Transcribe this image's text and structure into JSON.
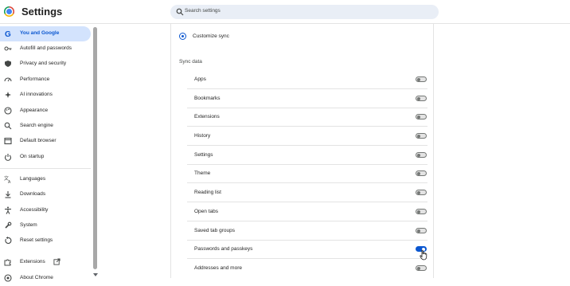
{
  "app": {
    "title": "Settings"
  },
  "search": {
    "placeholder": "Search settings"
  },
  "sidebar": {
    "items": [
      {
        "label": "You and Google",
        "icon": "google-g-icon",
        "active": true
      },
      {
        "label": "Autofill and passwords",
        "icon": "key-icon"
      },
      {
        "label": "Privacy and security",
        "icon": "shield-icon"
      },
      {
        "label": "Performance",
        "icon": "speedometer-icon"
      },
      {
        "label": "AI innovations",
        "icon": "sparkle-icon"
      },
      {
        "label": "Appearance",
        "icon": "palette-icon"
      },
      {
        "label": "Search engine",
        "icon": "search-icon"
      },
      {
        "label": "Default browser",
        "icon": "browser-icon"
      },
      {
        "label": "On startup",
        "icon": "power-icon"
      },
      {
        "label": "Languages",
        "icon": "translate-icon"
      },
      {
        "label": "Downloads",
        "icon": "download-icon"
      },
      {
        "label": "Accessibility",
        "icon": "accessibility-icon"
      },
      {
        "label": "System",
        "icon": "wrench-icon"
      },
      {
        "label": "Reset settings",
        "icon": "reset-icon"
      },
      {
        "label": "Extensions",
        "icon": "puzzle-icon"
      },
      {
        "label": "About Chrome",
        "icon": "chrome-icon"
      }
    ]
  },
  "main": {
    "customize_sync_label": "Customize sync",
    "sync_data_title": "Sync data",
    "rows": [
      {
        "label": "Apps",
        "enabled": false
      },
      {
        "label": "Bookmarks",
        "enabled": false
      },
      {
        "label": "Extensions",
        "enabled": false
      },
      {
        "label": "History",
        "enabled": false
      },
      {
        "label": "Settings",
        "enabled": false
      },
      {
        "label": "Theme",
        "enabled": false
      },
      {
        "label": "Reading list",
        "enabled": false
      },
      {
        "label": "Open tabs",
        "enabled": false
      },
      {
        "label": "Saved tab groups",
        "enabled": false
      },
      {
        "label": "Passwords and passkeys",
        "enabled": true
      },
      {
        "label": "Addresses and more",
        "enabled": false
      }
    ]
  },
  "colors": {
    "accent": "#0b57d0",
    "active_bg": "#d3e3fd",
    "search_bg": "#e9eef6"
  }
}
